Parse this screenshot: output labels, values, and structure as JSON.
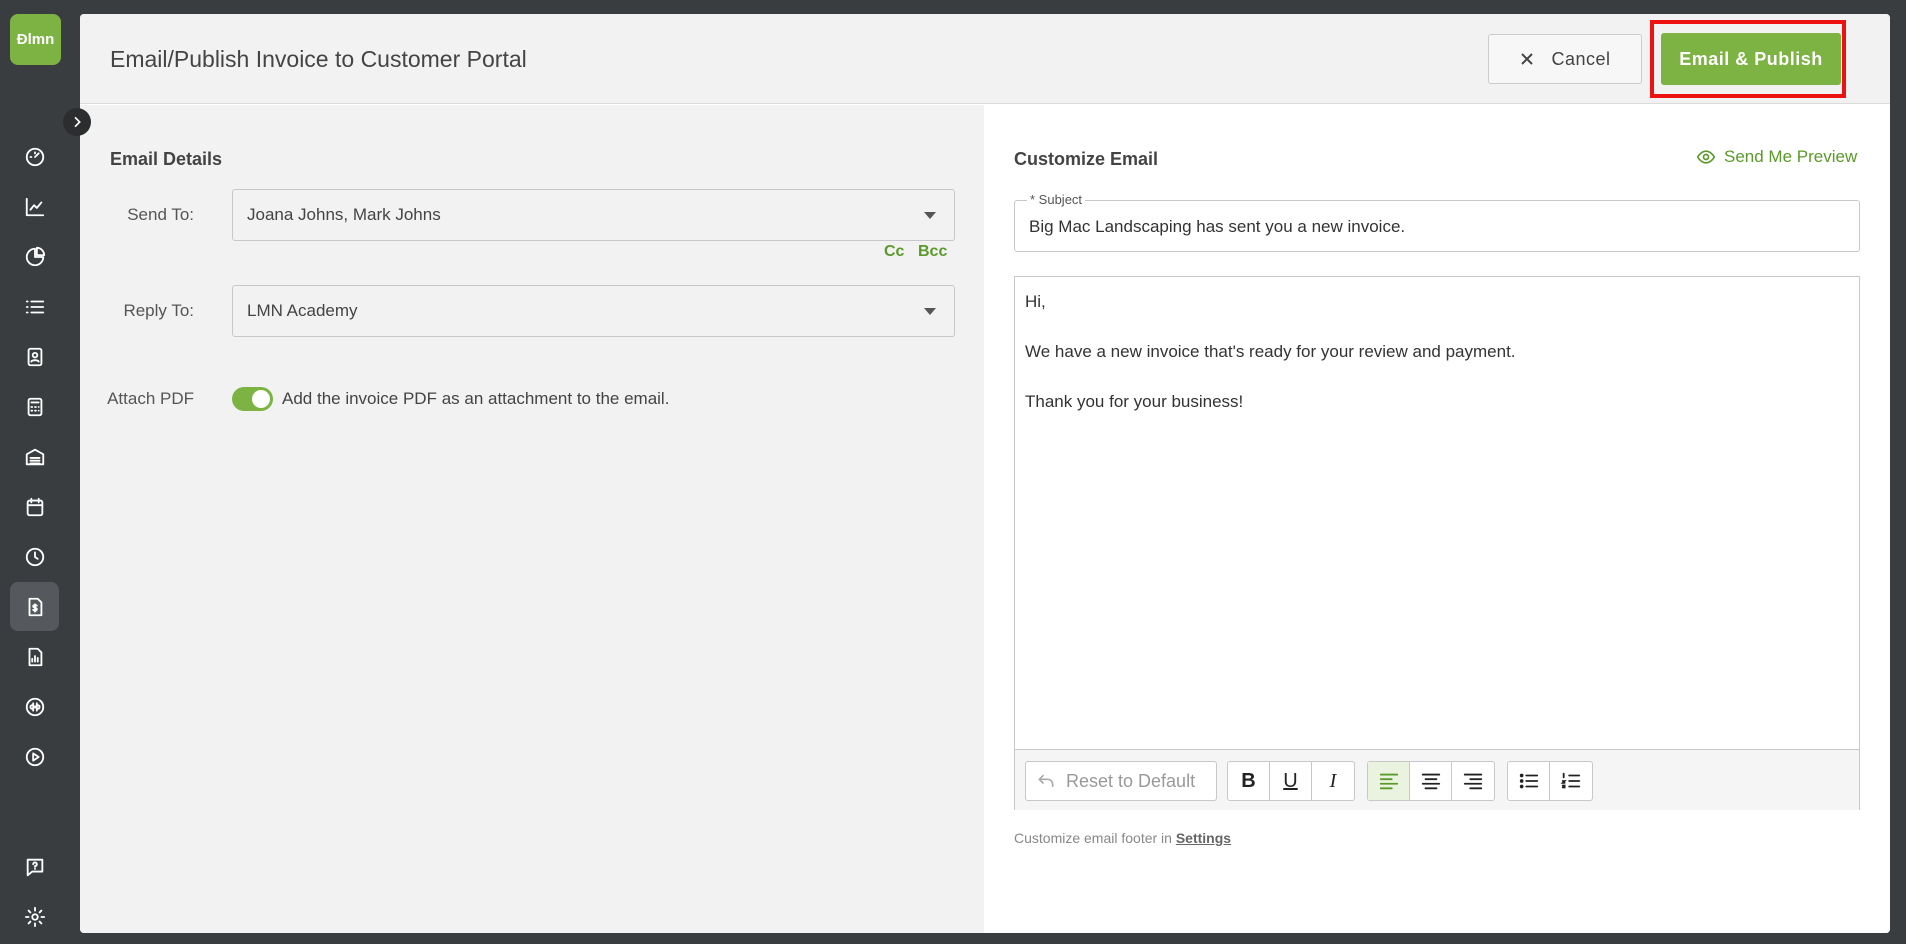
{
  "app": {
    "logo_text": "Ɖlmn",
    "brand_color": "#7cb342",
    "accent_color": "#5a9a2a",
    "highlight_color": "#ee1111"
  },
  "sidebar": {
    "items": [
      {
        "icon": "dashboard-icon"
      },
      {
        "icon": "chart-line-icon"
      },
      {
        "icon": "pie-chart-icon"
      },
      {
        "icon": "list-icon"
      },
      {
        "icon": "contact-card-icon"
      },
      {
        "icon": "calculator-icon"
      },
      {
        "icon": "warehouse-icon"
      },
      {
        "icon": "calendar-icon"
      },
      {
        "icon": "clock-icon"
      },
      {
        "icon": "invoice-icon",
        "active": true
      },
      {
        "icon": "report-icon"
      },
      {
        "icon": "quickbooks-icon"
      },
      {
        "icon": "play-icon"
      }
    ],
    "bottom_items": [
      {
        "icon": "help-icon"
      },
      {
        "icon": "settings-gear-icon"
      }
    ]
  },
  "modal": {
    "title": "Email/Publish Invoice to Customer Portal",
    "cancel_label": "Cancel",
    "publish_label": "Email & Publish"
  },
  "email_details": {
    "title": "Email Details",
    "send_to_label": "Send To:",
    "send_to_value": "Joana Johns, Mark Johns",
    "cc_label": "Cc",
    "bcc_label": "Bcc",
    "reply_to_label": "Reply To:",
    "reply_to_value": "LMN Academy",
    "attach_pdf_label": "Attach PDF",
    "attach_pdf_enabled": true,
    "attach_pdf_text": "Add the invoice PDF as an attachment to the email."
  },
  "customize_email": {
    "title": "Customize Email",
    "preview_label": "Send Me Preview",
    "subject_label": "* Subject",
    "subject_value": "Big Mac Landscaping has sent you a new invoice.",
    "body": {
      "greeting": "Hi,",
      "line1": "We have a new invoice that's ready for your review and payment.",
      "closing": "Thank you for your business!"
    },
    "toolbar": {
      "reset_label": "Reset to Default",
      "bold": "B",
      "underline": "U",
      "italic": "I"
    },
    "footer_note": "Customize email footer in",
    "footer_link": "Settings"
  }
}
